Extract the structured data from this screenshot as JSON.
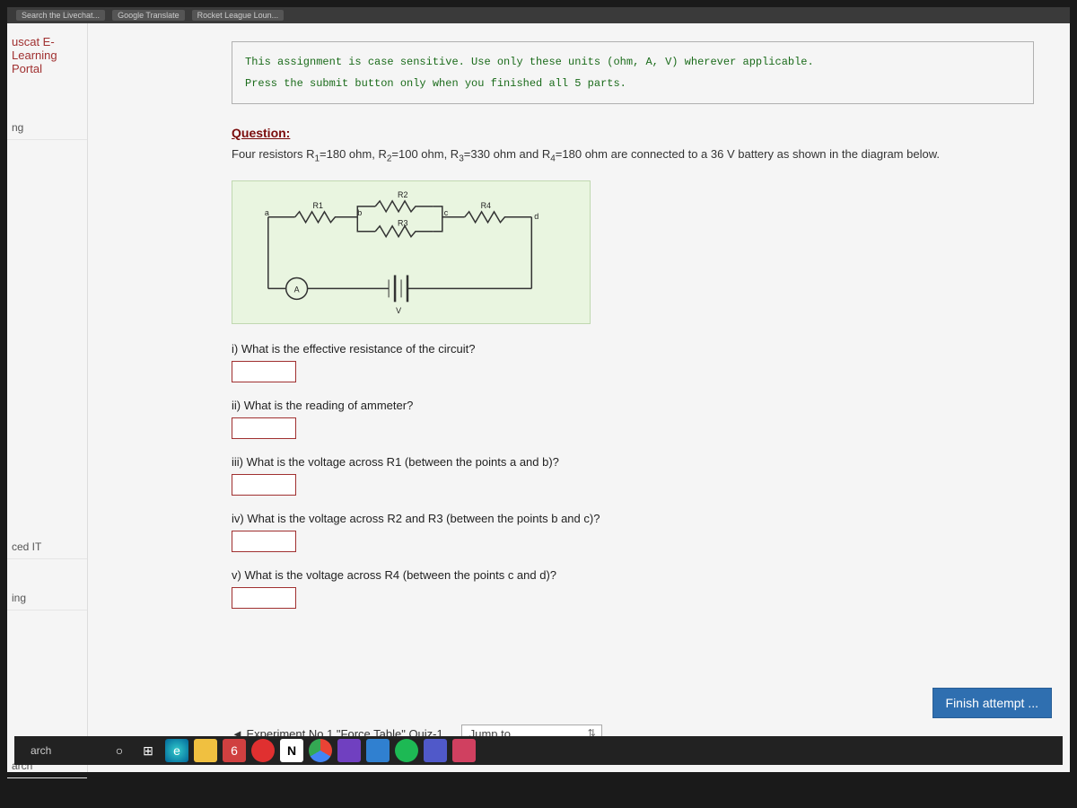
{
  "browser": {
    "bookmarks": [
      "Search the Livechat...",
      "Google Translate",
      "Rocket League Loun..."
    ]
  },
  "portal_title": "uscat E-Learning Portal",
  "sidebar": {
    "items": [
      "ng",
      "ced IT",
      "ing",
      "arch"
    ]
  },
  "instructions": {
    "line1": "This assignment is case sensitive. Use only these units (ohm, A, V) wherever applicable.",
    "line2": "Press the submit button only when you finished all 5 parts."
  },
  "question": {
    "header": "Question:",
    "text_prefix": "Four resistors R",
    "r1": "=180 ohm, R",
    "r2": "=100 ohm, R",
    "r3": "=330 ohm and R",
    "r4": "=180 ohm are connected to a 36 V battery as shown in the diagram below."
  },
  "diagram": {
    "labels": {
      "R1": "R1",
      "R2": "R2",
      "R3": "R3",
      "R4": "R4",
      "a": "a",
      "b": "b",
      "c": "c",
      "d": "d",
      "A": "A",
      "V": "V"
    }
  },
  "subquestions": {
    "q1": "i) What is the effective resistance of the circuit?",
    "q2": "ii) What is the reading of ammeter?",
    "q3": "iii) What is the voltage across R1 (between the points a and b)?",
    "q4": "iv) What is the voltage across R2 and R3 (between the points b and c)?",
    "q5": "v) What is the voltage across R4 (between the points c and d)?"
  },
  "finish_label": "Finish attempt ...",
  "nav": {
    "prev": "◄ Experiment No.1 \"Force Table\" Quiz-1",
    "jump": "Jump to..."
  },
  "taskbar": {
    "search": "arch"
  }
}
